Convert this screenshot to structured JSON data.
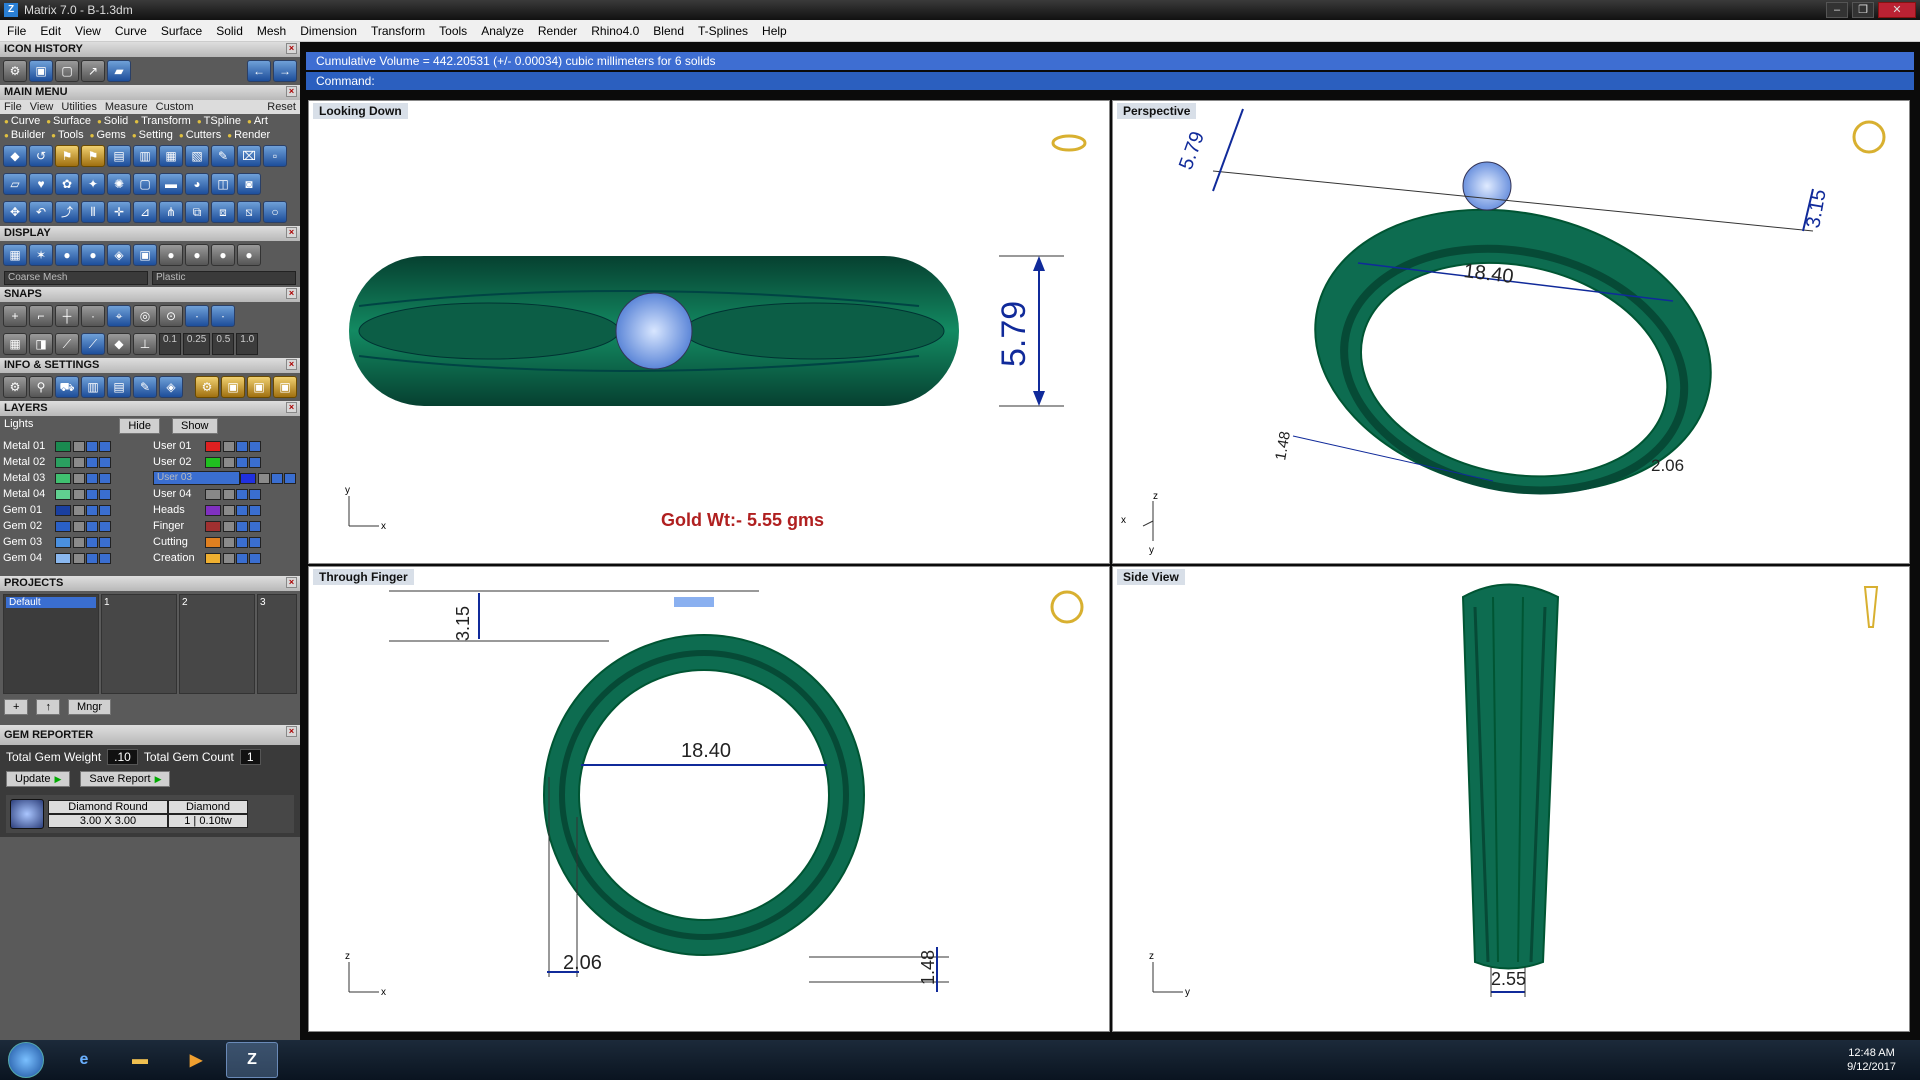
{
  "window": {
    "title": "Matrix 7.0 - B-1.3dm",
    "app_icon": "Z"
  },
  "menu": [
    "File",
    "Edit",
    "View",
    "Curve",
    "Surface",
    "Solid",
    "Mesh",
    "Dimension",
    "Transform",
    "Tools",
    "Analyze",
    "Render",
    "Rhino4.0",
    "Blend",
    "T-Splines",
    "Help"
  ],
  "panels": {
    "icon_history": "ICON HISTORY",
    "main_menu": "MAIN MENU",
    "main_tabs": [
      "File",
      "View",
      "Utilities",
      "Measure",
      "Custom"
    ],
    "reset": "Reset",
    "categories_row1": [
      "Curve",
      "Surface",
      "Solid",
      "Transform",
      "TSpline",
      "Art"
    ],
    "categories_row2": [
      "Builder",
      "Tools",
      "Gems",
      "Setting",
      "Cutters",
      "Render"
    ],
    "display": "DISPLAY",
    "display_mesh": "Coarse Mesh",
    "display_material": "Plastic",
    "snaps": "SNAPS",
    "snap_values": [
      "0.1",
      "0.25",
      "0.5",
      "1.0"
    ],
    "info_settings": "INFO & SETTINGS",
    "layers": "LAYERS",
    "layers_lights": "Lights",
    "layers_hide": "Hide",
    "layers_show": "Show",
    "projects": "PROJECTS",
    "project_default": "Default",
    "project_cols": [
      "1",
      "2",
      "3"
    ],
    "project_mngr": "Mngr",
    "gem_reporter": "GEM REPORTER"
  },
  "layers_left": [
    {
      "name": "Metal 01",
      "color": "#1a8a50"
    },
    {
      "name": "Metal 02",
      "color": "#2aa060"
    },
    {
      "name": "Metal 03",
      "color": "#40c070"
    },
    {
      "name": "Metal 04",
      "color": "#60d090"
    },
    {
      "name": "Gem 01",
      "color": "#1a3fa0"
    },
    {
      "name": "Gem 02",
      "color": "#2a60c8"
    },
    {
      "name": "Gem 03",
      "color": "#4a90e0"
    },
    {
      "name": "Gem 04",
      "color": "#8ab8f0"
    }
  ],
  "layers_right": [
    {
      "name": "User 01",
      "color": "#e02020",
      "selected": false
    },
    {
      "name": "User 02",
      "color": "#20c020",
      "selected": false
    },
    {
      "name": "User 03",
      "color": "#2030e0",
      "selected": true
    },
    {
      "name": "User 04",
      "color": "#888888",
      "selected": false
    },
    {
      "name": "Heads",
      "color": "#8030c0",
      "selected": false
    },
    {
      "name": "Finger",
      "color": "#a03030",
      "selected": false
    },
    {
      "name": "Cutting",
      "color": "#e08020",
      "selected": false
    },
    {
      "name": "Creation",
      "color": "#f0b030",
      "selected": false
    }
  ],
  "gem": {
    "total_weight_label": "Total Gem Weight",
    "total_weight": ".10",
    "total_count_label": "Total Gem Count",
    "total_count": "1",
    "update": "Update",
    "save_report": "Save Report",
    "row_shape": "Diamond Round",
    "row_material": "Diamond",
    "row_size": "3.00 X 3.00",
    "row_qty": "1",
    "row_ctw": "0.10tw"
  },
  "status": {
    "cumulative": "Cumulative Volume = 442.20531 (+/- 0.00034) cubic millimeters for 6 solids",
    "command": "Command:"
  },
  "viewports": {
    "top_left": {
      "label": "Looking Down",
      "dim": "5.79",
      "note": "Gold Wt:- 5.55 gms",
      "axis_x": "x",
      "axis_y": "y"
    },
    "top_right": {
      "label": "Perspective",
      "dims": [
        "5.79",
        "3.15",
        "18.40",
        "1.48",
        "2.06"
      ],
      "axis_x": "x",
      "axis_y": "y",
      "axis_z": "z"
    },
    "bottom_left": {
      "label": "Through Finger",
      "dims": [
        "3.15",
        "18.40",
        "2.06",
        "1.48"
      ],
      "axis_x": "x",
      "axis_z": "z"
    },
    "bottom_right": {
      "label": "Side View",
      "dim": "2.55",
      "axis_y": "y",
      "axis_z": "z"
    }
  },
  "colors": {
    "ring": "#0e6e52",
    "ring_dark": "#064030",
    "gem": "#8ab0f0",
    "dim": "#102a9a",
    "note": "#b02020"
  },
  "taskbar": {
    "time": "12:48 AM",
    "date": "9/12/2017",
    "active_app": "Z"
  }
}
